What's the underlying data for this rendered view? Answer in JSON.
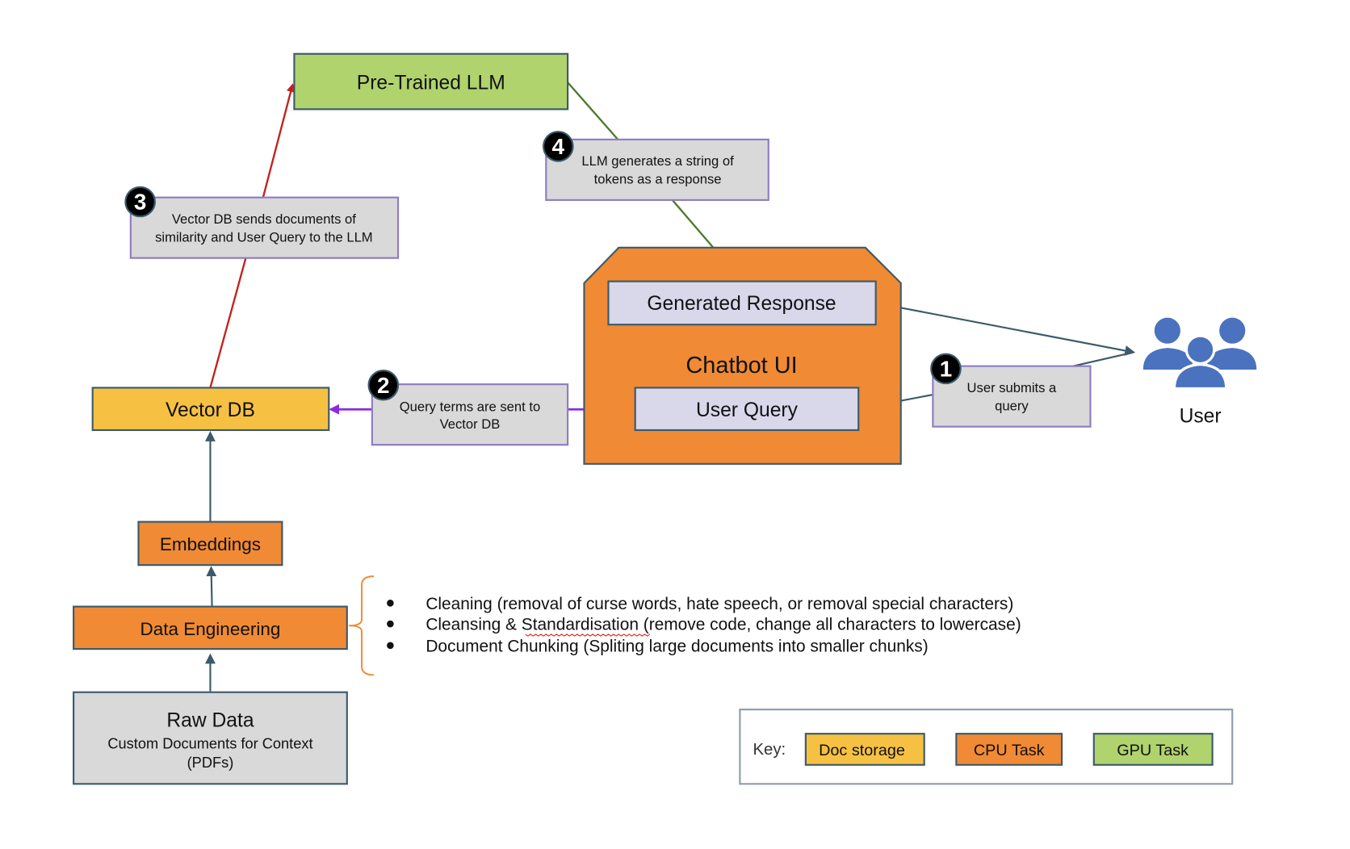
{
  "colors": {
    "gpu_task": "#b0d36e",
    "cpu_task": "#f08a35",
    "doc_storage": "#f6c142",
    "note_fill": "#d9d9d9",
    "note_border": "#8e7cc3",
    "ui_component": "#d9d7ea",
    "user_icon": "#4a72be",
    "arrow_llm_input": "#c0231f",
    "arrow_llm_output": "#4d7a2a",
    "arrow_query": "#8a2be2",
    "arrow_default": "#3c5a6b"
  },
  "nodes": {
    "llm": "Pre-Trained LLM",
    "chatbot": "Chatbot UI",
    "generated_response": "Generated Response",
    "user_query": "User Query",
    "vector_db": "Vector DB",
    "embeddings": "Embeddings",
    "data_engineering": "Data Engineering",
    "raw_data_title": "Raw Data",
    "raw_data_line1": "Custom Documents for Context",
    "raw_data_line2": "(PDFs)",
    "user": "User"
  },
  "steps": [
    {
      "number": "1",
      "line1": "User submits a",
      "line2": "query"
    },
    {
      "number": "2",
      "line1": "Query terms are sent to",
      "line2": "Vector DB"
    },
    {
      "number": "3",
      "line1": "Vector DB sends documents of",
      "line2": "similarity and User Query to the LLM"
    },
    {
      "number": "4",
      "line1": "LLM generates a string of",
      "line2": "tokens as a response"
    }
  ],
  "data_engineering_steps": [
    "Cleaning (removal of curse words, hate speech, or removal special characters)",
    "Cleansing & Standardisation (remove code, change all characters to lowercase)",
    "Document Chunking (Spliting large documents into smaller chunks)"
  ],
  "key": {
    "label": "Key:",
    "items": [
      "Doc storage",
      "CPU Task",
      "GPU Task"
    ]
  },
  "icons": {
    "user": "users-group-icon",
    "bullet": "bullet-icon"
  }
}
